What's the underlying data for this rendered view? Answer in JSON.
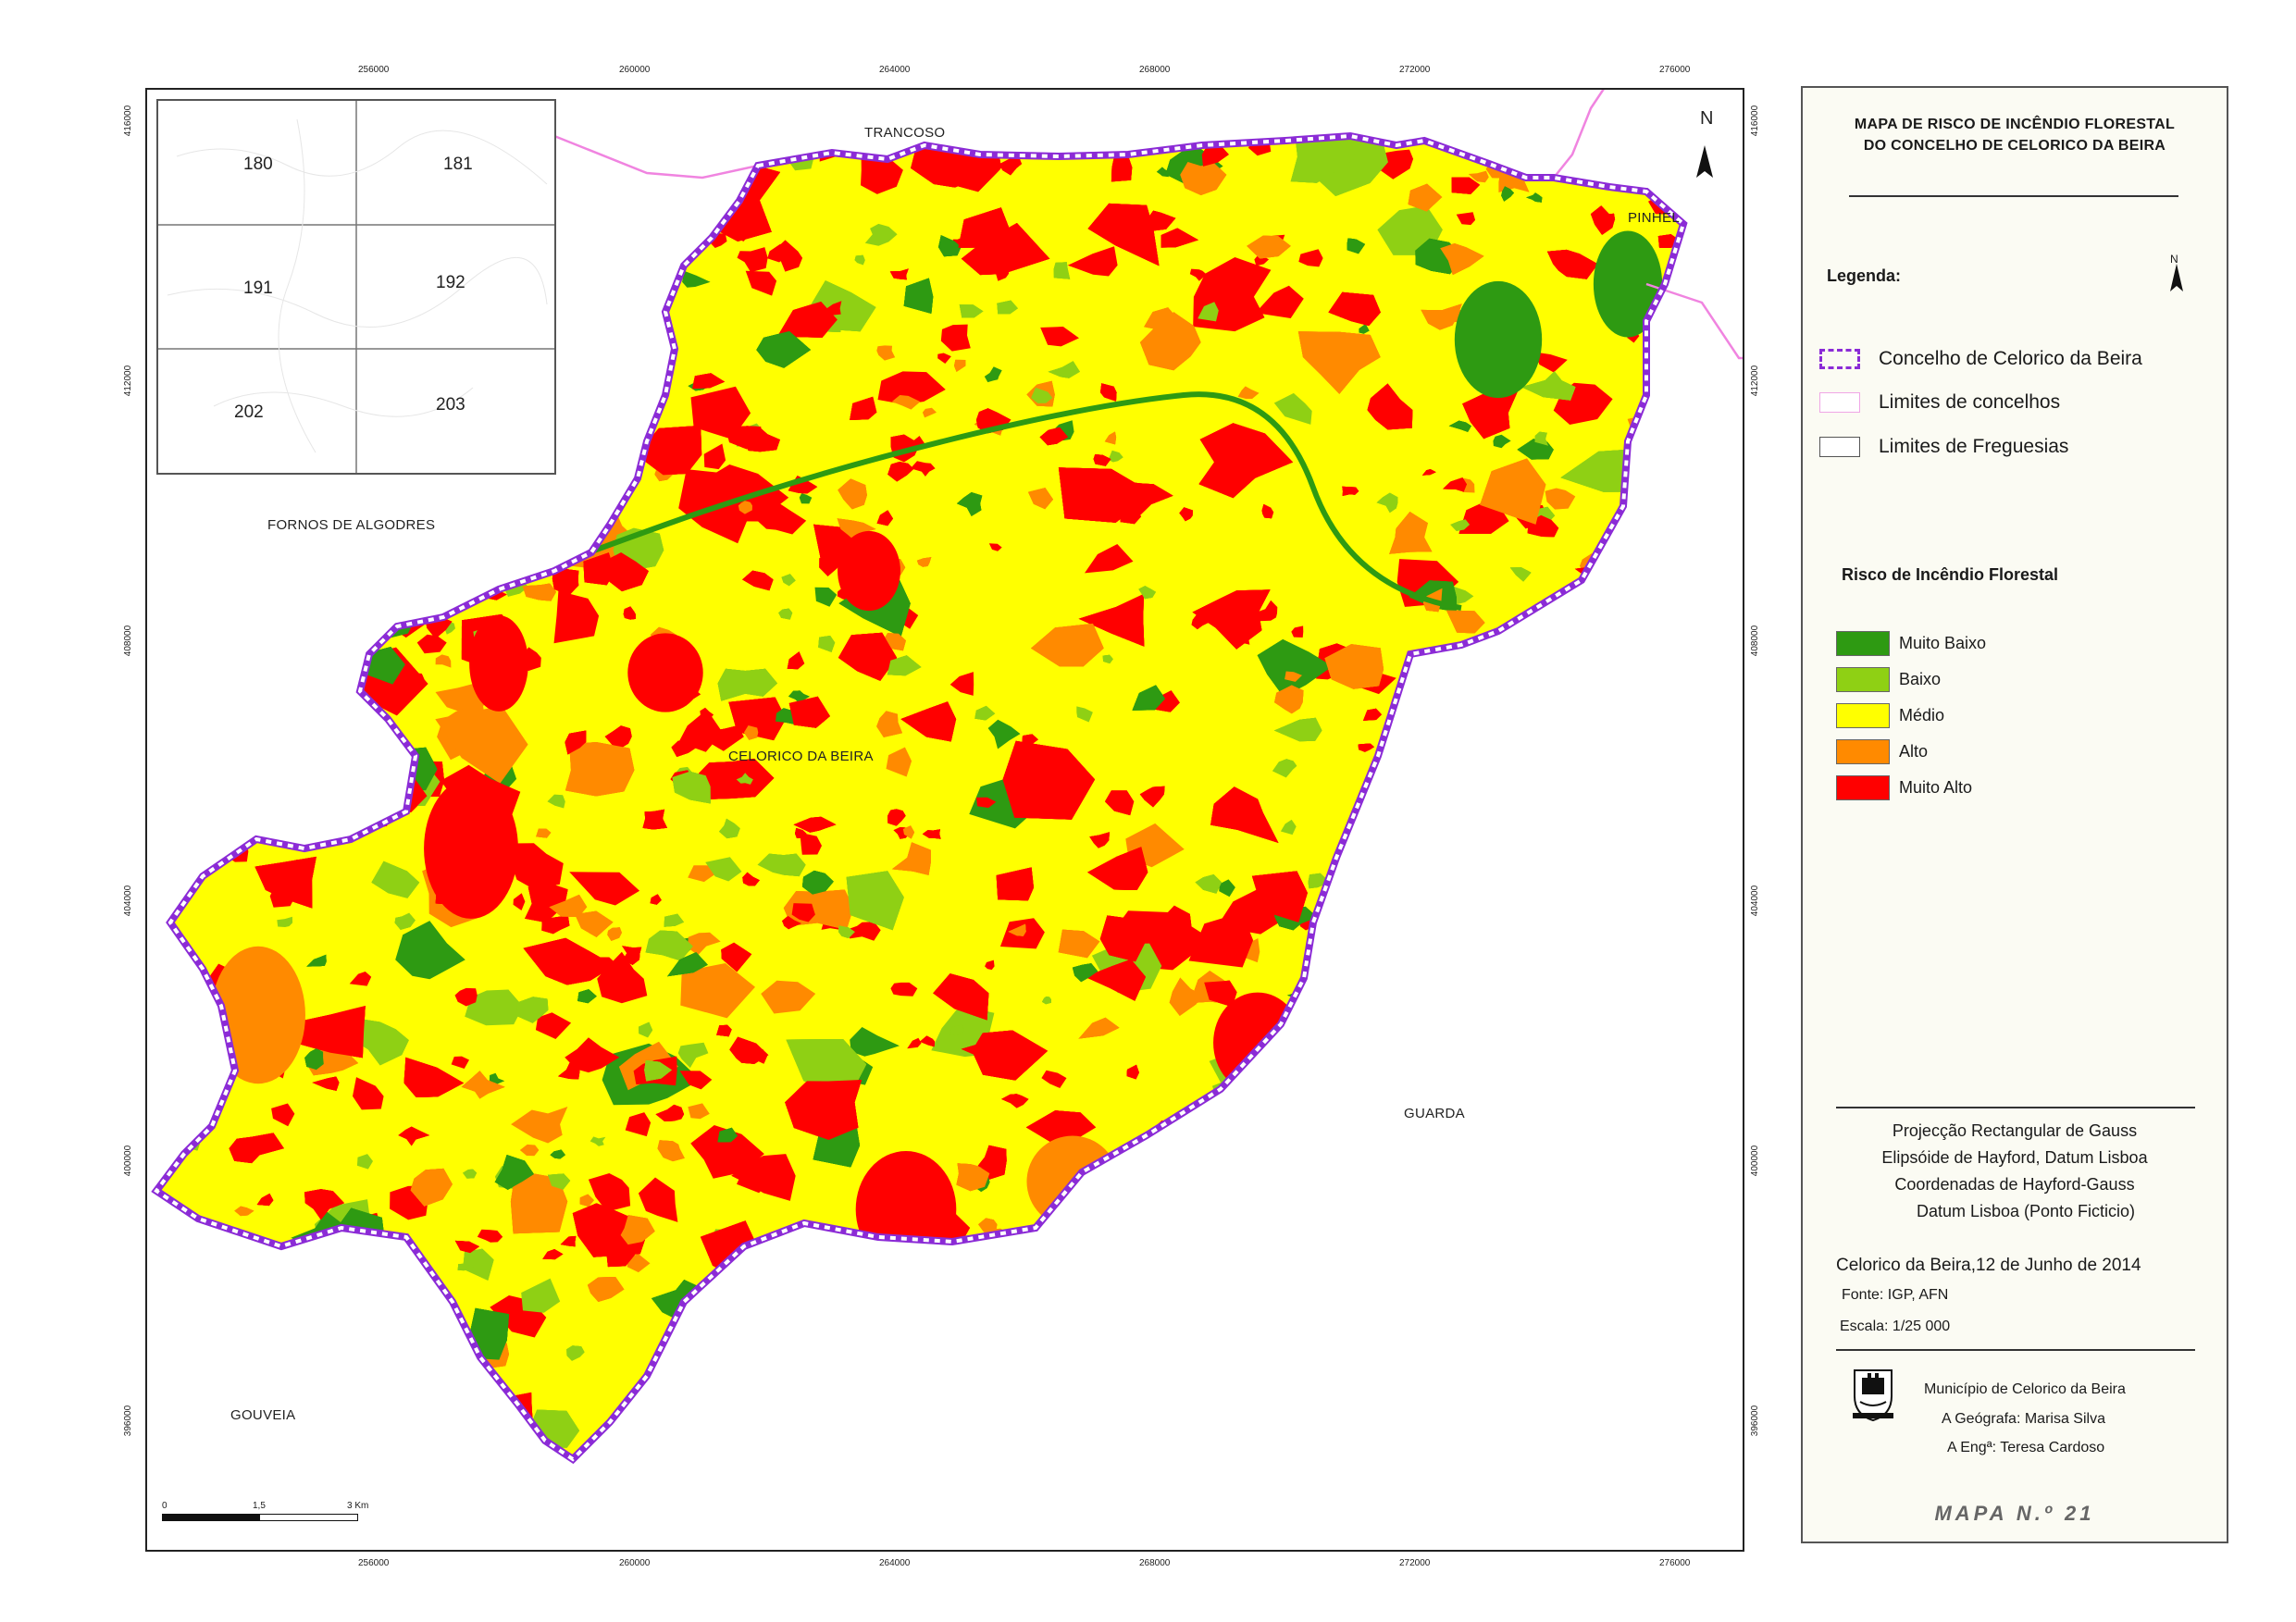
{
  "map": {
    "top_ticks": [
      "256000",
      "260000",
      "264000",
      "268000",
      "272000",
      "276000"
    ],
    "bottom_ticks": [
      "256000",
      "260000",
      "264000",
      "268000",
      "272000",
      "276000"
    ],
    "left_ticks": [
      "416000",
      "412000",
      "408000",
      "404000",
      "400000",
      "396000"
    ],
    "right_ticks": [
      "416000",
      "412000",
      "408000",
      "404000",
      "400000",
      "396000"
    ],
    "places": {
      "trancoso": "TRANCOSO",
      "pinhel": "PINHEL",
      "fornos": "FORNOS DE ALGODRES",
      "celorico": "CELORICO DA BEIRA",
      "guarda": "GUARDA",
      "gouveia": "GOUVEIA"
    },
    "north": "N",
    "inset_cells": [
      "180",
      "181",
      "191",
      "192",
      "202",
      "203"
    ],
    "scale_labels": [
      "0",
      "1,5",
      "3 Km"
    ]
  },
  "panel": {
    "title_line1": "MAPA DE RISCO DE INCÊNDIO FLORESTAL",
    "title_line2": "DO CONCELHO DE CELORICO DA BEIRA",
    "legend_heading": "Legenda:",
    "north": "N",
    "legend_items": [
      {
        "label": "Concelho de Celorico da Beira",
        "color": "#8b2bd6"
      },
      {
        "label": "Limites de concelhos",
        "color": "#f0a6e6"
      },
      {
        "label": "Limites de Freguesias",
        "color": "#555555"
      }
    ],
    "risk_heading": "Risco de Incêndio Florestal",
    "risk_classes": [
      {
        "label": "Muito Baixo",
        "color": "#2e9a12"
      },
      {
        "label": "Baixo",
        "color": "#8fd014"
      },
      {
        "label": "Médio",
        "color": "#ffff00"
      },
      {
        "label": "Alto",
        "color": "#ff8a00"
      },
      {
        "label": "Muito Alto",
        "color": "#ff0000"
      }
    ],
    "projection": [
      "Projecção Rectangular de Gauss",
      "Elipsóide de Hayford, Datum Lisboa",
      "Coordenadas de Hayford-Gauss",
      "Datum Lisboa (Ponto Ficticio)"
    ],
    "date": "Celorico da Beira,12 de Junho de 2014",
    "source": "Fonte: IGP, AFN",
    "scale": "Escala: 1/25 000",
    "municipality": "Município de Celorico da Beira",
    "geographer": "A Geógrafa: Marisa Silva",
    "engineer": "A Engª: Teresa Cardoso",
    "map_number": "MAPA N.º 21"
  }
}
